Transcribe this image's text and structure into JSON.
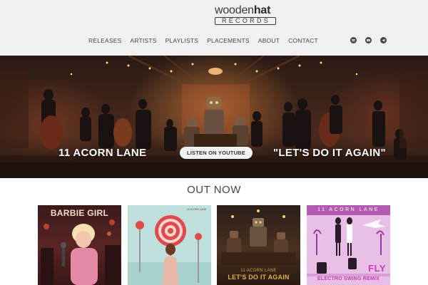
{
  "brand": {
    "logo_top_light": "wooden",
    "logo_top_bold": "hat",
    "logo_bottom": "RECORDS"
  },
  "nav": {
    "items": [
      {
        "label": "RELEASES"
      },
      {
        "label": "ARTISTS"
      },
      {
        "label": "PLAYLISTS"
      },
      {
        "label": "PLACEMENTS"
      },
      {
        "label": "ABOUT"
      },
      {
        "label": "CONTACT"
      }
    ],
    "social": [
      "spotify-icon",
      "youtube-icon",
      "telegram-icon"
    ]
  },
  "hero": {
    "left_title": "11 ACORN LANE",
    "button_label": "LISTEN ON YOUTUBE",
    "right_title": "\"LET'S DO IT AGAIN\""
  },
  "out_now": {
    "title": "OUT NOW",
    "albums": [
      {
        "title": "BARBIE GIRL"
      },
      {
        "tag": "11 ACORN LANE"
      },
      {
        "line1": "11 ACORN LANE",
        "line2": "LET'S DO IT AGAIN"
      },
      {
        "top": "11 ACORN LANE",
        "title": "FLY",
        "subtitle": "ELECTRO SWING REMIX"
      }
    ]
  },
  "colors": {
    "header_bg": "#f1f1f1",
    "accent_magenta": "#c63eaf"
  }
}
